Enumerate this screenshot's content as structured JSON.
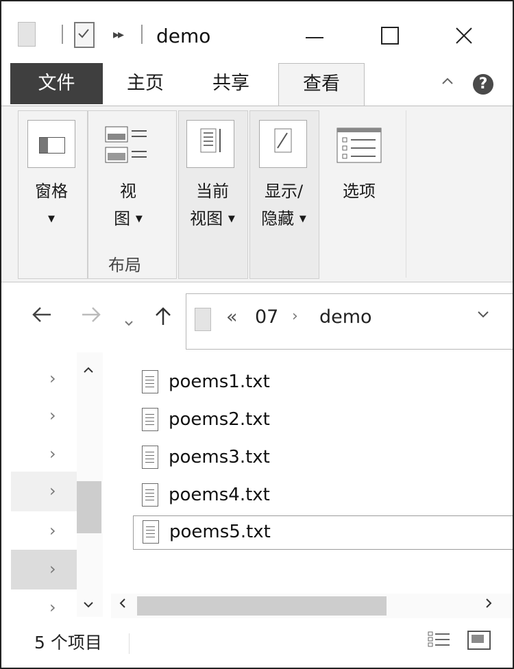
{
  "window": {
    "title": "demo"
  },
  "tabs": {
    "file": "文件",
    "home": "主页",
    "share": "共享",
    "view": "查看"
  },
  "help_label": "?",
  "ribbon": {
    "pane_label": "窗格",
    "layout_label_1": "视",
    "layout_label_2": "图",
    "current_view_1": "当前",
    "current_view_2": "视图",
    "show_hide_1": "显示/",
    "show_hide_2": "隐藏",
    "options_label": "选项",
    "layout_group": "布局"
  },
  "address": {
    "chevron": "«",
    "crumbs": [
      "07",
      "demo"
    ]
  },
  "files": [
    "poems1.txt",
    "poems2.txt",
    "poems3.txt",
    "poems4.txt",
    "poems5.txt"
  ],
  "status": {
    "item_count": "5 个项目"
  }
}
